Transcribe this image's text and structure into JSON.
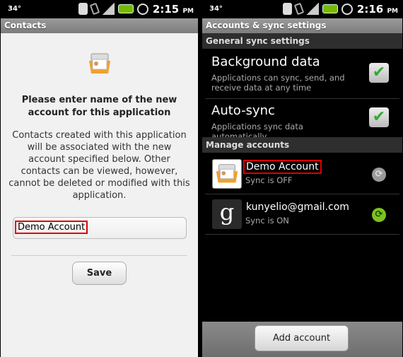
{
  "left": {
    "status": {
      "temp": "34°",
      "time": "2:15",
      "ampm": "PM"
    },
    "title": "Contacts",
    "prompt_title": "Please enter name of the new account for this application",
    "prompt_body": "Contacts created with this application will be associated with the new account specified below. Other contacts can be viewed, however, cannot be deleted or modified with this application.",
    "account_input_value": "Demo Account",
    "save_label": "Save"
  },
  "right": {
    "status": {
      "temp": "34°",
      "time": "2:16",
      "ampm": "PM"
    },
    "title": "Accounts & sync settings",
    "general_header": "General sync settings",
    "background_data": {
      "title": "Background data",
      "summary": "Applications can sync, send, and receive data at any time",
      "checked": true
    },
    "auto_sync": {
      "title": "Auto-sync",
      "summary": "Applications sync data automatically",
      "checked": true
    },
    "manage_header": "Manage accounts",
    "accounts": [
      {
        "name": "Demo Account",
        "status": "Sync is OFF",
        "sync_on": false
      },
      {
        "name": "kunyelio@gmail.com",
        "status": "Sync is ON",
        "sync_on": true
      }
    ],
    "add_account_label": "Add account",
    "checkmark": "✔",
    "sync_glyph": "⟳",
    "google_glyph": "g"
  },
  "colors": {
    "highlight": "#e00000",
    "sync_on": "#7cc31f",
    "sync_off": "#9a9a9a"
  }
}
